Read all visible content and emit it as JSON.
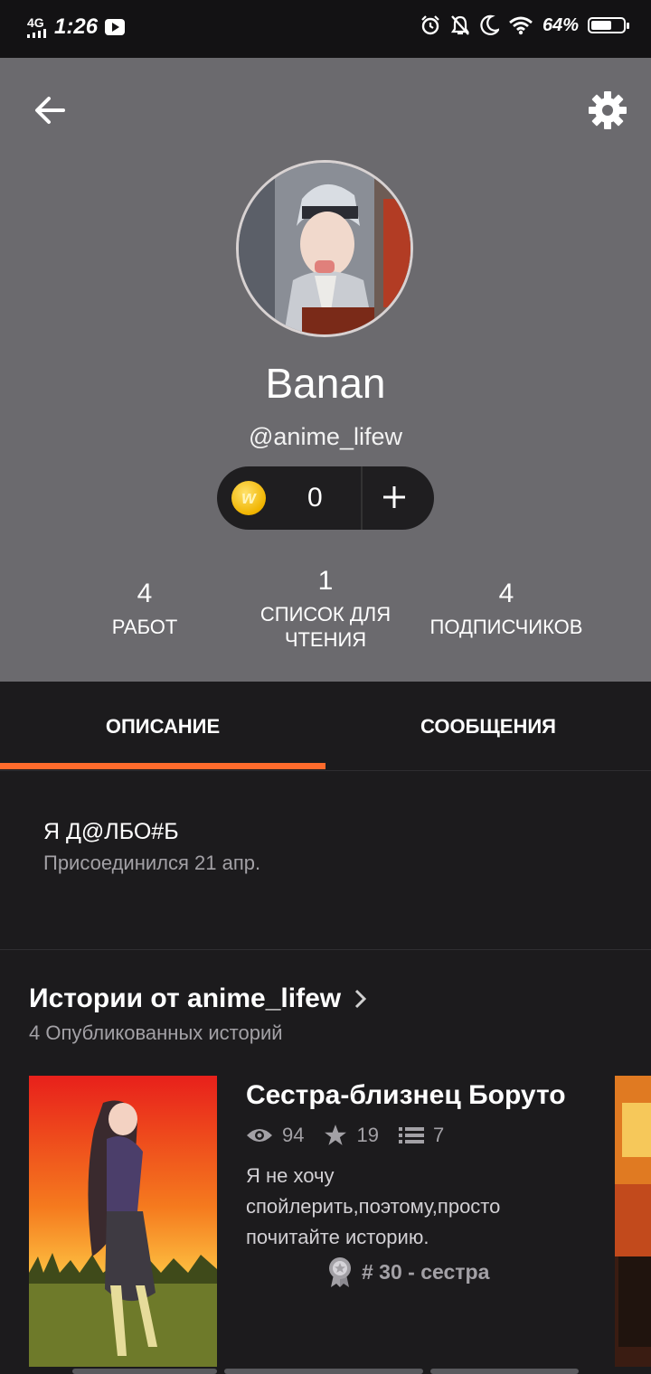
{
  "status_bar": {
    "network": "4G",
    "time": "1:26",
    "battery_percent": "64%",
    "battery_level": 0.64,
    "icons": [
      "signal-icon",
      "youtube-icon",
      "alarm-icon",
      "bell-off-icon",
      "moon-icon",
      "wifi-icon",
      "battery-icon"
    ]
  },
  "profile": {
    "display_name": "Banan",
    "username": "@anime_lifew",
    "coins": {
      "icon_letter": "w",
      "count": "0",
      "add_icon": "plus-icon"
    },
    "stats": [
      {
        "value": "4",
        "label": "РАБОТ"
      },
      {
        "value": "1",
        "label": "СПИСОК ДЛЯ ЧТЕНИЯ"
      },
      {
        "value": "4",
        "label": "ПОДПИСЧИКОВ"
      }
    ]
  },
  "tabs": [
    {
      "label": "ОПИСАНИЕ",
      "active": true
    },
    {
      "label": "СООБЩЕНИЯ",
      "active": false
    }
  ],
  "about": {
    "description": "Я Д@ЛБО#Б",
    "joined": "Присоединился 21 апр."
  },
  "stories": {
    "title": "Истории от anime_lifew",
    "subtitle": "4 Опубликованных историй",
    "items": [
      {
        "title": "Сестра-близнец Боруто",
        "reads": "94",
        "votes": "19",
        "parts": "7",
        "summary": "Я не хочу спойлерить,поэтому,просто почитайте историю.",
        "rank": "# 30 - сестра"
      }
    ]
  },
  "colors": {
    "header_bg": "#6b6a6e",
    "page_bg": "#1c1b1d",
    "accent": "#ff6b2c",
    "coin": "#f0b400"
  }
}
